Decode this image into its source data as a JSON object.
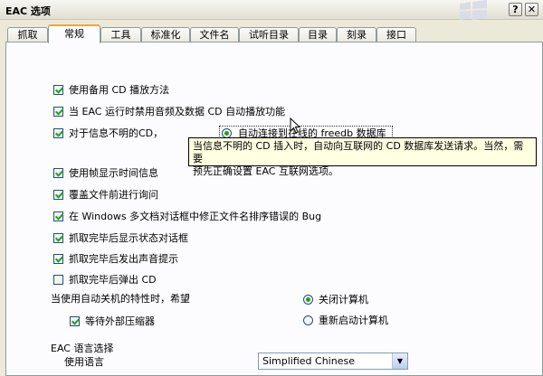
{
  "window": {
    "title": "EAC 选项",
    "help_glyph": "?",
    "close_glyph": "✕"
  },
  "tabs": [
    {
      "label": "抓取"
    },
    {
      "label": "常规"
    },
    {
      "label": "工具"
    },
    {
      "label": "标准化"
    },
    {
      "label": "文件名"
    },
    {
      "label": "试听目录"
    },
    {
      "label": "目录"
    },
    {
      "label": "刻录"
    },
    {
      "label": "接口"
    }
  ],
  "active_tab": "常规",
  "options": {
    "alt_cd_play": {
      "label": "使用备用 CD 播放方法",
      "checked": true
    },
    "disable_autoplay": {
      "label": "当 EAC 运行时禁用音频及数据 CD 自动播放功能",
      "checked": true
    },
    "unknown_cd": {
      "label": "对于信息不明的CD，",
      "checked": true
    },
    "auto_freedb": {
      "label": "自动连接到在线的 freedb 数据库"
    },
    "frame_display": {
      "label": "使用帧显示时间信息",
      "checked": true
    },
    "ask_overwrite": {
      "label": "覆盖文件前进行询问",
      "checked": true
    },
    "fix_sort_bug": {
      "label": "在 Windows 多文档对话框中修正文件名排序错误的 Bug",
      "checked": true
    },
    "show_status": {
      "label": "抓取完毕后显示状态对话框",
      "checked": true
    },
    "play_sound": {
      "label": "抓取完毕后发出声音提示",
      "checked": true
    },
    "eject_cd": {
      "label": "抓取完毕后弹出 CD",
      "checked": false
    }
  },
  "tooltip": {
    "line1": "当信息不明的 CD 插入时，自动向互联网的 CD 数据库发送请求。当然，需要",
    "line2": "预先正确设置 EAC 互联网选项。"
  },
  "shutdown": {
    "prompt": "当使用自动关机的特性时，希望",
    "wait_compressor": {
      "label": "等待外部压缩器",
      "checked": true
    },
    "shutdown_pc": {
      "label": "关闭计算机",
      "selected": true
    },
    "restart_pc": {
      "label": "重新启动计算机",
      "selected": false
    }
  },
  "language": {
    "section_title": "EAC 语言选择",
    "label": "使用语言",
    "selected": "Simplified Chinese",
    "dropdown_glyph": "▼"
  },
  "colors": {
    "accent": "#f3a435",
    "check": "#21a121",
    "tooltip_bg": "#ffffe1"
  }
}
